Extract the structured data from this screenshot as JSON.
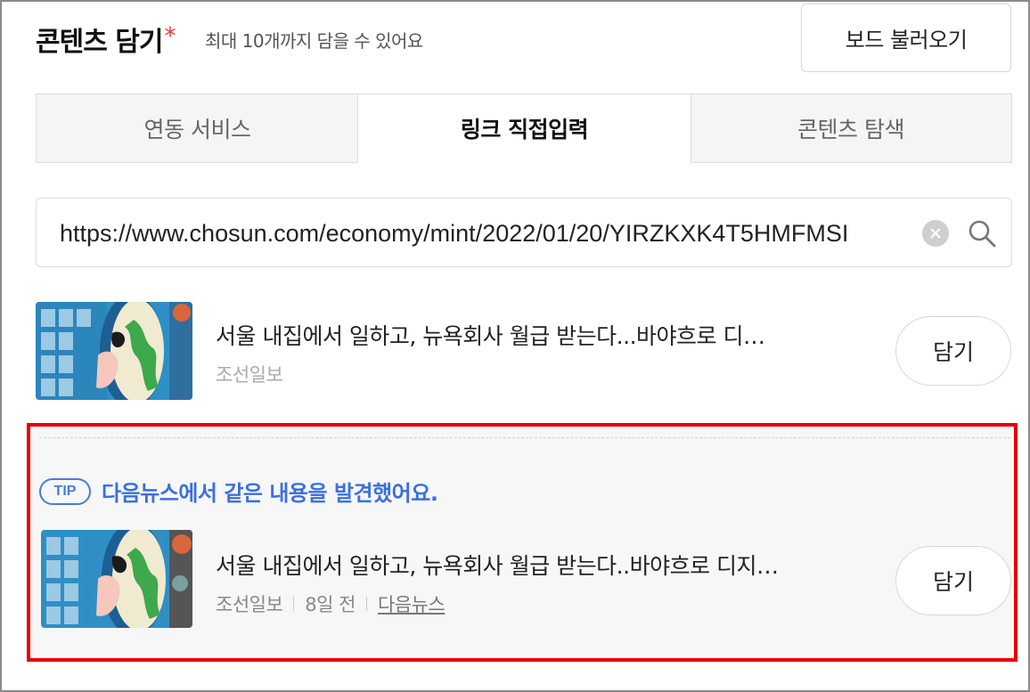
{
  "header": {
    "title": "콘텐츠 담기",
    "required_mark": "*",
    "description": "최대 10개까지 담을 수 있어요",
    "load_board_label": "보드 불러오기"
  },
  "tabs": [
    {
      "label": "연동 서비스",
      "active": false
    },
    {
      "label": "링크 직접입력",
      "active": true
    },
    {
      "label": "콘텐츠 탐색",
      "active": false
    }
  ],
  "search": {
    "value": "https://www.chosun.com/economy/mint/2022/01/20/YIRZKXK4T5HMFMSI"
  },
  "result": {
    "title": "서울 내집에서 일하고, 뉴욕회사 월급 받는다...바야흐로 디…",
    "source": "조선일보",
    "add_label": "담기"
  },
  "tip": {
    "badge": "TIP",
    "message": "다음뉴스에서 같은 내용을 발견했어요.",
    "item": {
      "title": "서울 내집에서 일하고, 뉴욕회사 월급 받는다..바야흐로 디지…",
      "source": "조선일보",
      "age": "8일 전",
      "origin_link": "다음뉴스",
      "add_label": "담기"
    }
  },
  "colors": {
    "accent_blue": "#3b6fe0",
    "highlight_red": "#e60000",
    "required_red": "#e53935"
  }
}
